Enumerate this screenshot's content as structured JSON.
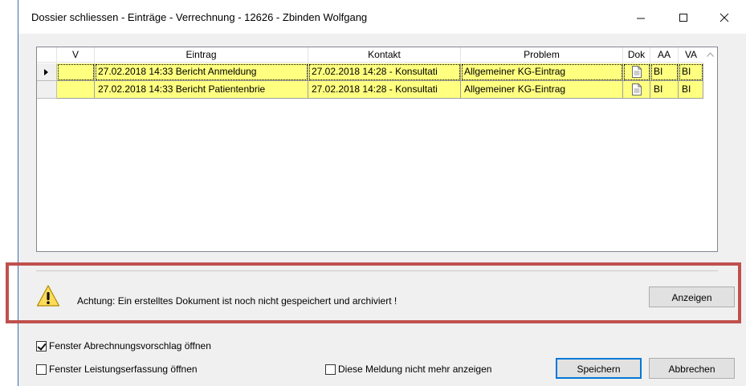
{
  "window": {
    "title": "Dossier schliessen - Einträge - Verrechnung - 12626 - Zbinden Wolfgang",
    "minimize_glyph": "—",
    "maximize_glyph": "☐",
    "close_glyph": "✕"
  },
  "grid": {
    "columns": [
      "V",
      "Eintrag",
      "Kontakt",
      "Problem",
      "Dok",
      "AA",
      "VA"
    ],
    "rows": [
      {
        "selected": true,
        "v": "",
        "eintrag": "27.02.2018 14:33 Bericht Anmeldung",
        "kontakt": "27.02.2018 14:28 - Konsultati",
        "problem": "Allgemeiner KG-Eintrag",
        "dok": "document-icon",
        "aa": "BI",
        "va": "BI"
      },
      {
        "selected": false,
        "v": "",
        "eintrag": "27.02.2018 14:33 Bericht Patientenbrie",
        "kontakt": "27.02.2018 14:28 - Konsultati",
        "problem": "Allgemeiner KG-Eintrag",
        "dok": "document-icon",
        "aa": "BI",
        "va": "BI"
      }
    ],
    "row_color": "#ffff80"
  },
  "warning": {
    "icon": "warning-icon",
    "message": "Achtung: Ein erstelltes Dokument ist noch nicht gespeichert und archiviert !",
    "show_button": "Anzeigen",
    "highlight_color": "#c0504d"
  },
  "options": {
    "open_billing_label": "Fenster Abrechnungsvorschlag öffnen",
    "open_billing_checked": true,
    "open_services_label": "Fenster Leistungserfassung öffnen",
    "open_services_checked": false,
    "dont_show_label": "Diese Meldung nicht mehr anzeigen",
    "dont_show_checked": false
  },
  "buttons": {
    "save": "Speichern",
    "cancel": "Abbrechen"
  }
}
